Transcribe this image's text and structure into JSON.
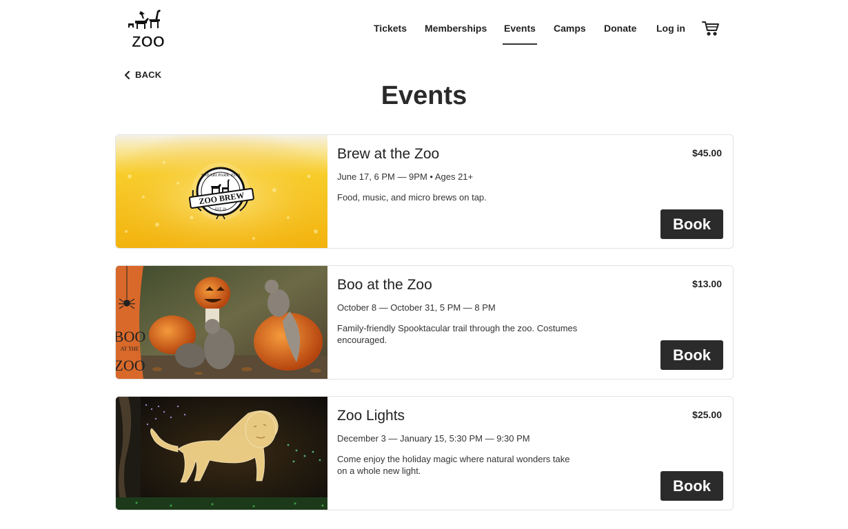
{
  "brand": {
    "logo_text": "ZOO"
  },
  "nav": {
    "items": [
      {
        "label": "Tickets"
      },
      {
        "label": "Memberships"
      },
      {
        "label": "Events"
      },
      {
        "label": "Camps"
      },
      {
        "label": "Donate"
      },
      {
        "label": "Log in"
      }
    ],
    "active": "Events",
    "cart_icon": "cart-icon"
  },
  "back": {
    "label": "BACK",
    "icon": "chevron-left-icon"
  },
  "page": {
    "title": "Events"
  },
  "events": [
    {
      "title": "Brew at the Zoo",
      "date": "June 17, 6 PM — 9PM • Ages 21+",
      "description": "Food, music, and micro brews on tap.",
      "price": "$45.00",
      "button": "Book",
      "image_badge_top": "SAFARI PARK ZOO",
      "image_badge_banner": "ZOO BREW",
      "image_badge_est": "EST. 20"
    },
    {
      "title": "Boo at the Zoo",
      "date": "October 8 — October 31, 5 PM — 8 PM",
      "description": "Family-friendly Spooktacular trail through the zoo. Costumes encouraged.",
      "price": "$13.00",
      "button": "Book",
      "image_text_1": "BOO",
      "image_text_2": "AT THE",
      "image_text_3": "ZOO"
    },
    {
      "title": "Zoo Lights",
      "date": "December 3 — January 15, 5:30 PM — 9:30 PM",
      "description": "Come enjoy the holiday magic where natural wonders take on a whole new light.",
      "price": "$25.00",
      "button": "Book"
    }
  ],
  "colors": {
    "button_bg": "#2b2b2b",
    "beer_yellow": "#f6c419",
    "boo_orange": "#d9692a",
    "lights_gold": "#f3d38a"
  }
}
